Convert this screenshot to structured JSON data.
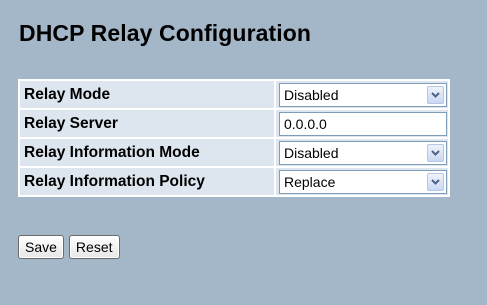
{
  "page": {
    "title": "DHCP Relay Configuration"
  },
  "form": {
    "rows": [
      {
        "label": "Relay Mode",
        "type": "select",
        "value": "Disabled"
      },
      {
        "label": "Relay Server",
        "type": "input",
        "value": "0.0.0.0"
      },
      {
        "label": "Relay Information Mode",
        "type": "select",
        "value": "Disabled"
      },
      {
        "label": "Relay Information Policy",
        "type": "select",
        "value": "Replace"
      }
    ]
  },
  "buttons": {
    "save": "Save",
    "reset": "Reset"
  },
  "icons": {
    "dropdown": "chevron-down-icon"
  },
  "colors": {
    "background": "#a4b7c9",
    "row": "#dde6ee"
  }
}
